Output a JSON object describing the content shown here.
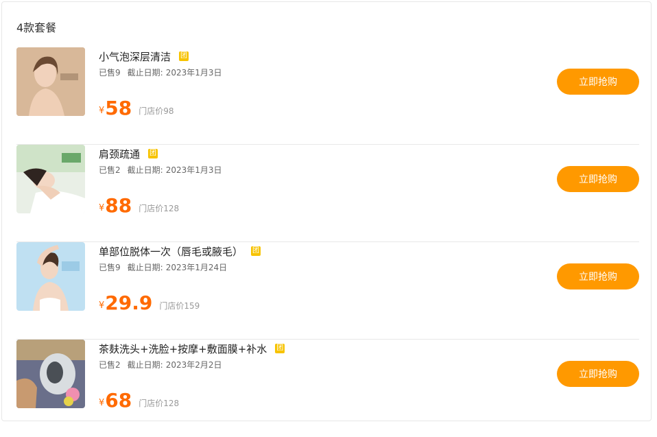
{
  "section": {
    "title": "4款套餐"
  },
  "deals": [
    {
      "name": "小气泡深层清洁",
      "badge": "团",
      "sold": "已售9",
      "deadline_label": "截止日期:",
      "deadline": "2023年1月3日",
      "currency": "¥",
      "price": "58",
      "store_price": "门店价98",
      "button": "立即抢购"
    },
    {
      "name": "肩颈疏通",
      "badge": "团",
      "sold": "已售2",
      "deadline_label": "截止日期:",
      "deadline": "2023年1月3日",
      "currency": "¥",
      "price": "88",
      "store_price": "门店价128",
      "button": "立即抢购"
    },
    {
      "name": "单部位脱体一次（唇毛或腋毛）",
      "badge": "团",
      "sold": "已售9",
      "deadline_label": "截止日期:",
      "deadline": "2023年1月24日",
      "currency": "¥",
      "price": "29.9",
      "store_price": "门店价159",
      "button": "立即抢购"
    },
    {
      "name": "茶麸洗头+洗脸+按摩+敷面膜+补水",
      "badge": "团",
      "sold": "已售2",
      "deadline_label": "截止日期:",
      "deadline": "2023年2月2日",
      "currency": "¥",
      "price": "68",
      "store_price": "门店价128",
      "button": "立即抢购"
    }
  ],
  "colors": {
    "accent": "#ff9900",
    "price": "#ff6a00",
    "badge": "#f7c300"
  }
}
